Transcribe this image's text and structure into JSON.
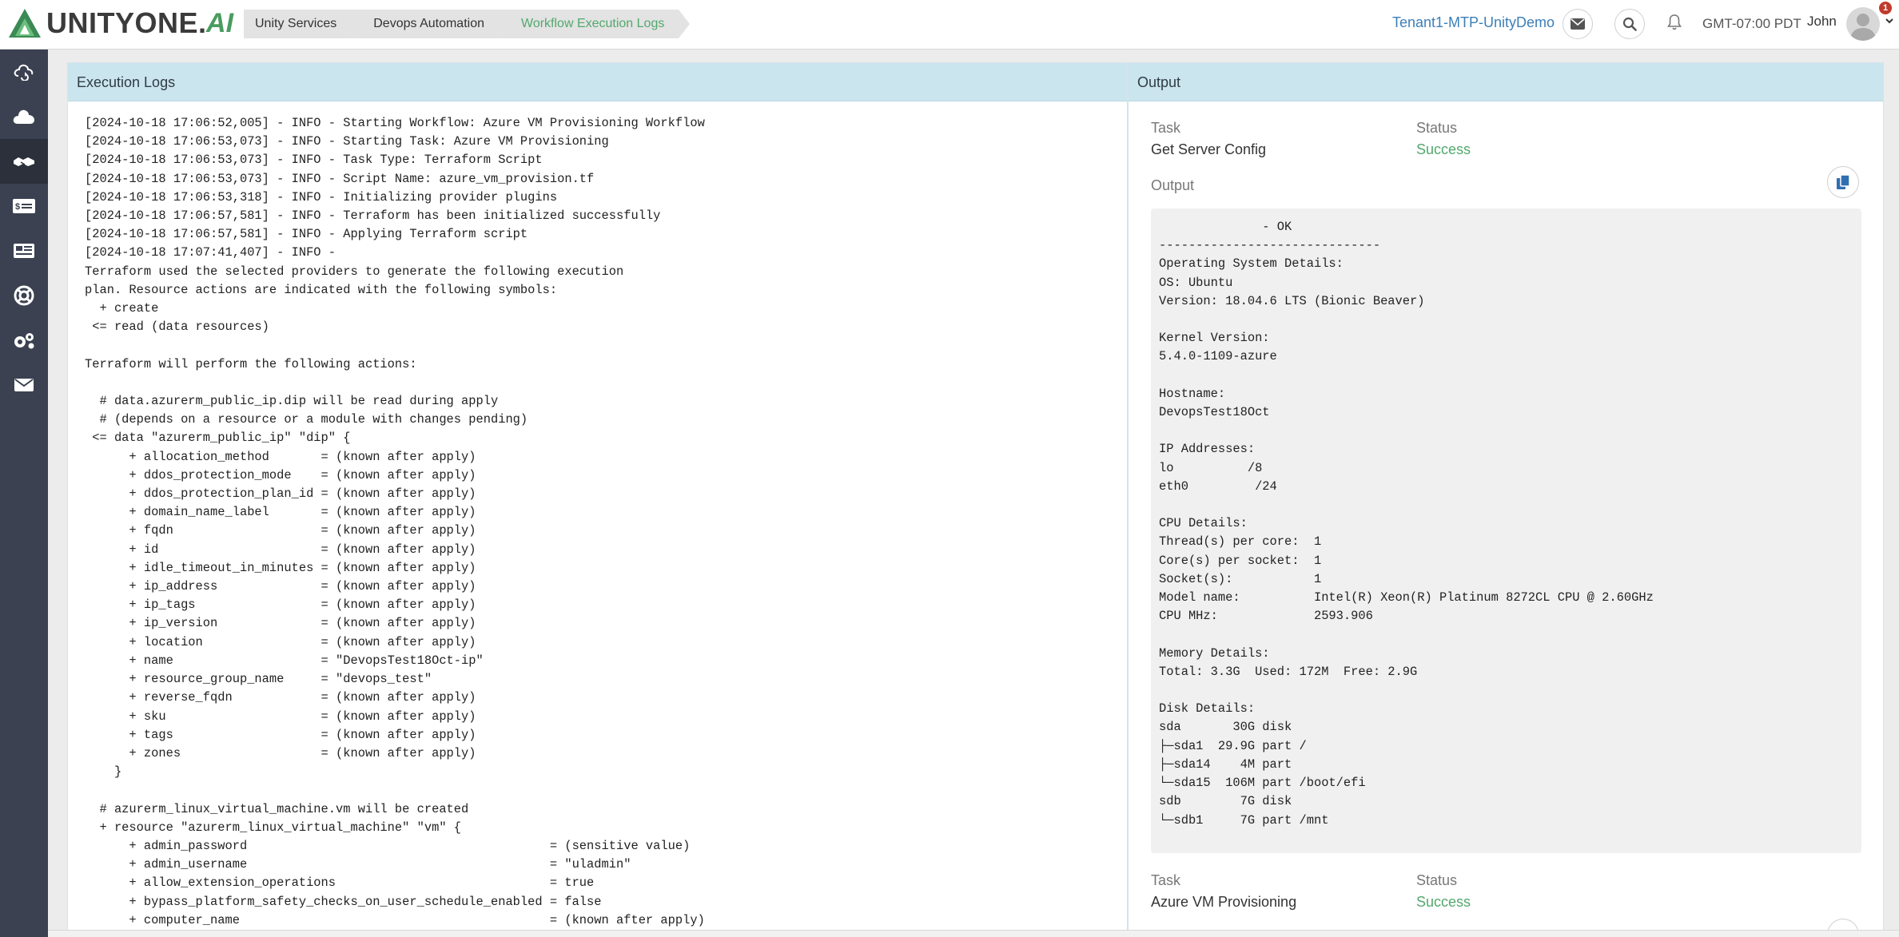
{
  "header": {
    "logo": {
      "word": "UNITYONE",
      "dot": ".",
      "ai": "AI"
    },
    "breadcrumbs": [
      "Unity Services",
      "Devops Automation",
      "Workflow Execution Logs"
    ],
    "tenant": "Tenant1-MTP-UnityDemo",
    "timezone": "GMT-07:00 PDT",
    "user": "John",
    "notification_count": "1"
  },
  "sidebar": {
    "items": [
      "cloud-sync-icon",
      "cloud-icon",
      "handshake-icon",
      "billing-icon",
      "news-icon",
      "support-icon",
      "settings-icon",
      "mail-icon"
    ],
    "active_index": 2
  },
  "logs": {
    "title": "Execution Logs",
    "text": "[2024-10-18 17:06:52,005] - INFO - Starting Workflow: Azure VM Provisioning Workflow\n[2024-10-18 17:06:53,073] - INFO - Starting Task: Azure VM Provisioning\n[2024-10-18 17:06:53,073] - INFO - Task Type: Terraform Script\n[2024-10-18 17:06:53,073] - INFO - Script Name: azure_vm_provision.tf\n[2024-10-18 17:06:53,318] - INFO - Initializing provider plugins\n[2024-10-18 17:06:57,581] - INFO - Terraform has been initialized successfully\n[2024-10-18 17:06:57,581] - INFO - Applying Terraform script\n[2024-10-18 17:07:41,407] - INFO -\nTerraform used the selected providers to generate the following execution\nplan. Resource actions are indicated with the following symbols:\n  + create\n <= read (data resources)\n\nTerraform will perform the following actions:\n\n  # data.azurerm_public_ip.dip will be read during apply\n  # (depends on a resource or a module with changes pending)\n <= data \"azurerm_public_ip\" \"dip\" {\n      + allocation_method       = (known after apply)\n      + ddos_protection_mode    = (known after apply)\n      + ddos_protection_plan_id = (known after apply)\n      + domain_name_label       = (known after apply)\n      + fqdn                    = (known after apply)\n      + id                      = (known after apply)\n      + idle_timeout_in_minutes = (known after apply)\n      + ip_address              = (known after apply)\n      + ip_tags                 = (known after apply)\n      + ip_version              = (known after apply)\n      + location                = (known after apply)\n      + name                    = \"DevopsTest18Oct-ip\"\n      + resource_group_name     = \"devops_test\"\n      + reverse_fqdn            = (known after apply)\n      + sku                     = (known after apply)\n      + tags                    = (known after apply)\n      + zones                   = (known after apply)\n    }\n\n  # azurerm_linux_virtual_machine.vm will be created\n  + resource \"azurerm_linux_virtual_machine\" \"vm\" {\n      + admin_password                                         = (sensitive value)\n      + admin_username                                         = \"uladmin\"\n      + allow_extension_operations                             = true\n      + bypass_platform_safety_checks_on_user_schedule_enabled = false\n      + computer_name                                          = (known after apply)"
  },
  "output": {
    "title": "Output",
    "task_label": "Task",
    "status_label": "Status",
    "output_label": "Output",
    "task1": {
      "name": "Get Server Config",
      "status": "Success"
    },
    "task2": {
      "name": "Azure VM Provisioning",
      "status": "Success"
    },
    "text": "              - OK\n------------------------------\nOperating System Details:\nOS: Ubuntu\nVersion: 18.04.6 LTS (Bionic Beaver)\n\nKernel Version:\n5.4.0-1109-azure\n\nHostname:\nDevopsTest18Oct\n\nIP Addresses:\nlo          /8\neth0         /24\n\nCPU Details:\nThread(s) per core:  1\nCore(s) per socket:  1\nSocket(s):           1\nModel name:          Intel(R) Xeon(R) Platinum 8272CL CPU @ 2.60GHz\nCPU MHz:             2593.906\n\nMemory Details:\nTotal: 3.3G  Used: 172M  Free: 2.9G\n\nDisk Details:\nsda       30G disk\n├─sda1  29.9G part /\n├─sda14    4M part\n└─sda15  106M part /boot/efi\nsdb        7G disk\n└─sdb1     7G part /mnt"
  },
  "colors": {
    "accent": "#52a86c",
    "link": "#3c7fb8",
    "panel_header": "#cbe5ef",
    "sidebar": "#3b4150"
  }
}
